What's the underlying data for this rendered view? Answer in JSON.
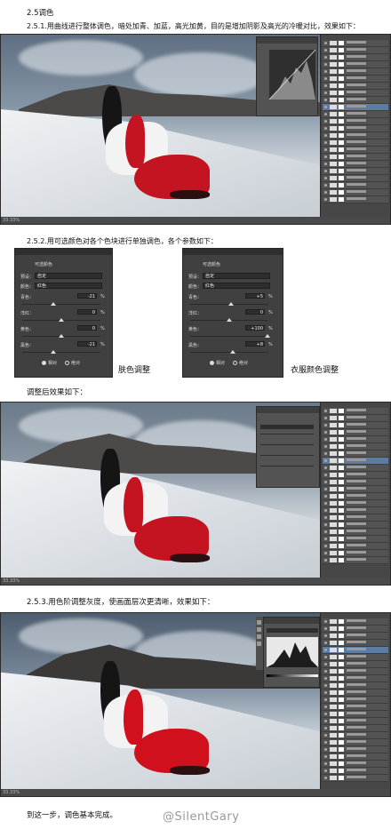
{
  "text": {
    "section_title": "2.5调色",
    "step1": "2.5.1.用曲线进行整体调色，暗处加青、加蓝，高光加黄，目的是增加阴影及高光的冷暖对比，效果如下：",
    "step2": "2.5.2.用可选颜色对各个色块进行单独调色，各个参数如下：",
    "caption_skin": "肤色调整",
    "caption_clothes": "衣服颜色调整",
    "after_adjust": "调整后效果如下：",
    "step3": "2.5.3.用色阶调整灰度，使画面层次更清晰，效果如下：",
    "conclusion": "到这一步，调色基本完成。",
    "watermark": "@SilentGary"
  },
  "panel_left": {
    "title": "可选颜色",
    "preset_label": "预设：",
    "preset_value": "自定",
    "color_label": "颜色：",
    "color_value": "红色",
    "rows": [
      {
        "label": "青色：",
        "value": "-21",
        "unit": "%"
      },
      {
        "label": "洋红：",
        "value": "0",
        "unit": "%"
      },
      {
        "label": "黄色：",
        "value": "0",
        "unit": "%"
      },
      {
        "label": "黑色：",
        "value": "-21",
        "unit": "%"
      }
    ],
    "radio_relative": "相对",
    "radio_absolute": "绝对"
  },
  "panel_right": {
    "title": "可选颜色",
    "preset_label": "预设：",
    "preset_value": "自定",
    "color_label": "颜色：",
    "color_value": "红色",
    "rows": [
      {
        "label": "青色：",
        "value": "+5",
        "unit": "%"
      },
      {
        "label": "洋红：",
        "value": "0",
        "unit": "%"
      },
      {
        "label": "黄色：",
        "value": "+100",
        "unit": "%"
      },
      {
        "label": "黑色：",
        "value": "+8",
        "unit": "%"
      }
    ],
    "radio_relative": "相对",
    "radio_absolute": "绝对"
  },
  "status": {
    "zoom1": "33.33%",
    "zoom2": "33.33%",
    "zoom3": "33.33%"
  }
}
